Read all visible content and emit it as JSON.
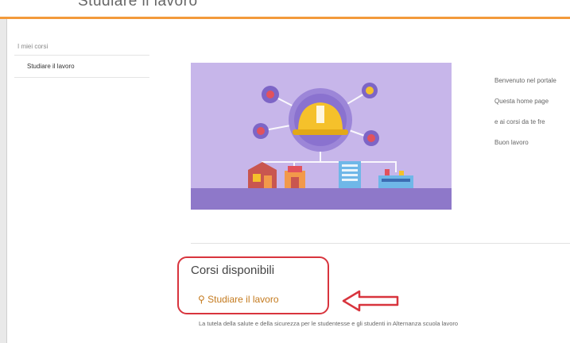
{
  "header": {
    "app_title": "Studiare il lavoro"
  },
  "sidebar": {
    "heading": "I miei corsi",
    "items": [
      {
        "label": "Studiare il lavoro"
      }
    ]
  },
  "welcome": {
    "lines": [
      "Benvenuto nel portale",
      "Questa home page",
      "e ai corsi da te fre",
      "Buon lavoro"
    ]
  },
  "courses": {
    "title": "Corsi disponibili",
    "link_label": "Studiare il lavoro",
    "description": "La tutela della salute e della sicurezza per le studentesse e gli studenti in Alternanza scuola lavoro"
  },
  "colors": {
    "accent_orange": "#f39a3b",
    "highlight_red": "#d8343d",
    "banner_bg": "#c7b6ea",
    "banner_floor": "#8e78c9"
  },
  "icons": {
    "banner": "safety-helmet-network-illustration",
    "annotation": "arrow-left-icon"
  }
}
